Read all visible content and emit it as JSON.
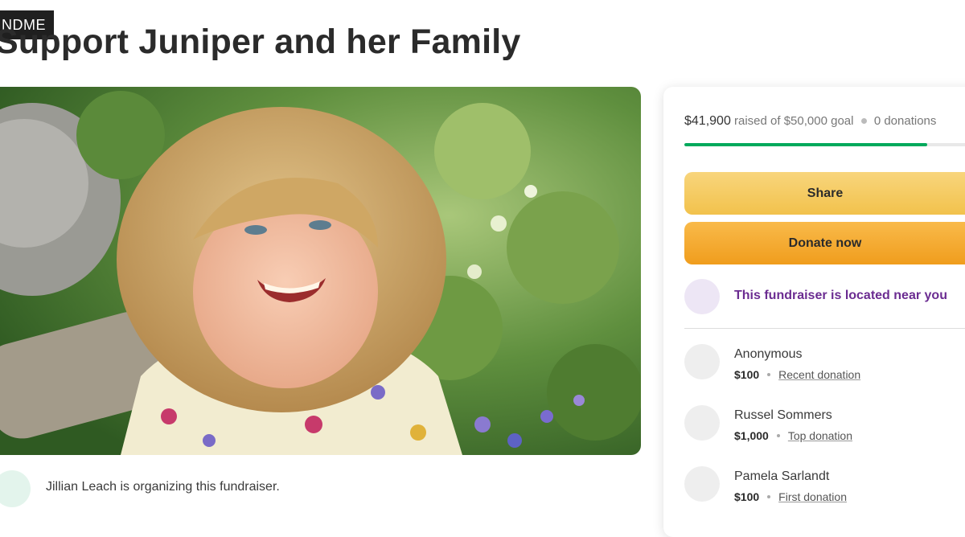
{
  "brand": {
    "tag_text": "NDME"
  },
  "page": {
    "title": "Support Juniper and her Family"
  },
  "hero": {
    "image_description_icon": "child-photo"
  },
  "organizer": {
    "text": "Jillian Leach is organizing this fundraiser."
  },
  "progress": {
    "raised": "$41,900",
    "goal_text": "raised of $50,000 goal",
    "donations_text": "0 donations",
    "fraction": 0.838
  },
  "buttons": {
    "share_label": "Share",
    "donate_label": "Donate now"
  },
  "location": {
    "text": "This fundraiser is located near you"
  },
  "donations": [
    {
      "name": "Anonymous",
      "amount": "$100",
      "tag": "Recent donation"
    },
    {
      "name": "Russel Sommers",
      "amount": "$1,000",
      "tag": "Top donation"
    },
    {
      "name": "Pamela Sarlandt",
      "amount": "$100",
      "tag": "First donation"
    }
  ],
  "colors": {
    "progress_fill": "#02a95c",
    "share_button": "#f2c24c",
    "donate_button": "#f09d1d",
    "location_text": "#6b2c91"
  }
}
